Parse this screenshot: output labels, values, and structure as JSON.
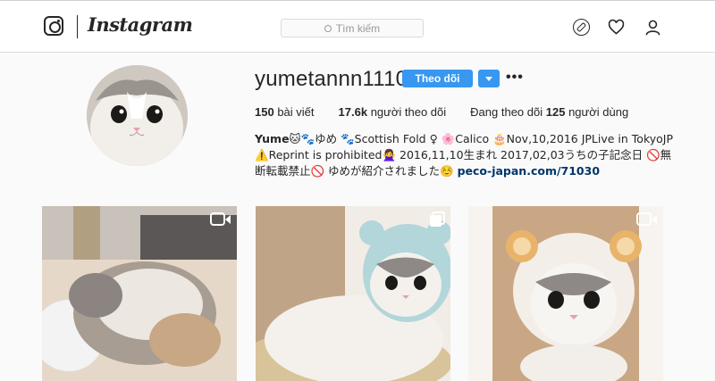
{
  "header": {
    "logo_text": "Instagram",
    "search_placeholder": "Tìm kiếm",
    "icons": [
      "instagram-glyph-icon",
      "search-icon",
      "compass-icon",
      "heart-icon",
      "person-icon"
    ]
  },
  "profile": {
    "username": "yumetannn1110",
    "follow_label": "Theo dõi",
    "more_label": "•••",
    "stats": {
      "posts_count": "150",
      "posts_label": "bài viết",
      "followers_count": "17.6k",
      "followers_label": "người theo dõi",
      "following_prefix": "Đang theo dõi",
      "following_count": "125",
      "following_suffix": "người dùng"
    },
    "bio": {
      "name": "Yume",
      "line1_rest": "🐱🐾ゆめ 🐾Scottish Fold ♀ 🌸Calico 🎂Nov,10,2016 JPLive in TokyoJP",
      "line2": "⚠️Reprint is prohibited🙅‍♀️ 2016,11,10生まれ 2017,02,03うちの子記念日 🚫無断転載禁止🚫 ゆめが紹介されました☺️",
      "link": "peco-japan.com/71030"
    }
  },
  "posts": [
    {
      "type": "video",
      "icon": "video-camera-icon"
    },
    {
      "type": "multiple",
      "icon": "multiple-posts-icon"
    },
    {
      "type": "video",
      "icon": "video-camera-icon"
    }
  ],
  "colors": {
    "accent": "#3897f0",
    "text": "#262626",
    "background": "#fafafa",
    "link": "#003569"
  }
}
